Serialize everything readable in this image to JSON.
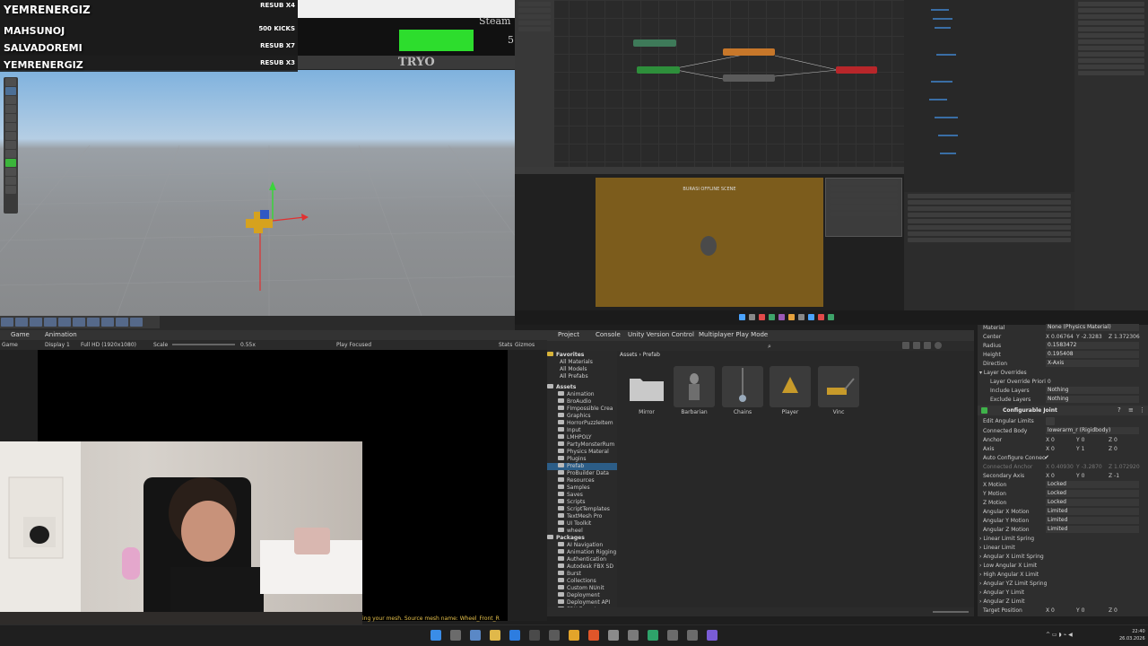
{
  "leaderboard": {
    "entries": [
      {
        "name": "YEMRENERGIZ",
        "badge": "RESUB X4"
      },
      {
        "name": "MAHSUNOJ",
        "badge": "500 KICKS"
      },
      {
        "name": "SALVADOREMI",
        "badge": "RESUB X7"
      },
      {
        "name": "YEMRENERGIZ",
        "badge": "RESUB X3"
      }
    ],
    "goal_text": "Steam",
    "goal_number": "5",
    "overlay_label": "TRYO"
  },
  "game_view": {
    "tabs": [
      "Game",
      "Animation"
    ],
    "toolbar": {
      "mode": "Game",
      "display": "Display 1",
      "resolution": "Full HD (1920x1080)",
      "scale_label": "Scale",
      "scale_value": "0.55x",
      "play_focused": "Play Focused",
      "stats": "Stats",
      "gizmos": "Gizmos"
    },
    "console_message": "ing your mesh. Source mesh name: Wheel_Front_R"
  },
  "inner_game": {
    "scene_label": "BURASI OFFLINE SCENE"
  },
  "project": {
    "tabs": [
      "Project",
      "Console",
      "Unity Version Control",
      "Multiplayer Play Mode"
    ],
    "favorites_header": "Favorites",
    "favorites": [
      "All Materials",
      "All Models",
      "All Prefabs"
    ],
    "assets_header": "Assets",
    "asset_folders": [
      "Animation",
      "BroAudio",
      "FImpossible Crea",
      "Graphics",
      "HorrorPuzzleItem",
      "Input",
      "LMHPOLY",
      "PartyMonsterRum",
      "Physics Materal",
      "Plugins",
      "Prefab",
      "ProBuilder Data",
      "Resources",
      "Samples",
      "Saves",
      "Scripts",
      "ScriptTemplates",
      "TextMesh Pro",
      "UI Toolkit",
      "wheel"
    ],
    "packages_header": "Packages",
    "package_folders": [
      "AI Navigation",
      "Animation Rigging",
      "Authentication",
      "Autodesk FBX SD",
      "Burst",
      "Collections",
      "Custom NUnit",
      "Deployment",
      "Deployment API",
      "FBX Exporter"
    ],
    "breadcrumb": [
      "Assets",
      "Prefab"
    ],
    "items": [
      {
        "name": "Mirror",
        "type": "folder"
      },
      {
        "name": "Barbarian",
        "type": "prefab"
      },
      {
        "name": "Chains",
        "type": "prefab"
      },
      {
        "name": "Player",
        "type": "prefab"
      },
      {
        "name": "Vinc",
        "type": "prefab"
      }
    ]
  },
  "inspector": {
    "material_label": "Material",
    "material_value": "None (Physics Material)",
    "center_label": "Center",
    "center_x": "0.06764",
    "center_y": "-2.3283",
    "center_z": "1.372306",
    "radius_label": "Radius",
    "radius_value": "0.1583472",
    "height_label": "Height",
    "height_value": "0.195408",
    "direction_label": "Direction",
    "direction_value": "X-Axis",
    "layer_overrides": "Layer Overrides",
    "layer_override_priority": "Layer Override Priori",
    "layer_override_priority_value": "0",
    "include_layers": "Include Layers",
    "include_layers_value": "Nothing",
    "exclude_layers": "Exclude Layers",
    "exclude_layers_value": "Nothing",
    "component_title": "Configurable Joint",
    "edit_angular_limits": "Edit Angular Limits",
    "connected_body": "Connected Body",
    "connected_body_value": "lowerarm_r (Rigidbody)",
    "anchor": "Anchor",
    "anchor_x": "0",
    "anchor_y": "0",
    "anchor_z": "0",
    "axis": "Axis",
    "axis_x": "0",
    "axis_y": "1",
    "axis_z": "0",
    "auto_configure": "Auto Configure Connec",
    "connected_anchor": "Connected Anchor",
    "connected_anchor_x": "0.40930",
    "connected_anchor_y": "-3.2870",
    "connected_anchor_z": "1.072920",
    "secondary_axis": "Secondary Axis",
    "secondary_x": "0",
    "secondary_y": "0",
    "secondary_z": "-1",
    "motions": [
      {
        "label": "X Motion",
        "value": "Locked"
      },
      {
        "label": "Y Motion",
        "value": "Locked"
      },
      {
        "label": "Z Motion",
        "value": "Locked"
      },
      {
        "label": "Angular X Motion",
        "value": "Limited"
      },
      {
        "label": "Angular Y Motion",
        "value": "Limited"
      },
      {
        "label": "Angular Z Motion",
        "value": "Limited"
      }
    ],
    "foldouts": [
      "Linear Limit Spring",
      "Linear Limit",
      "Angular X Limit Spring",
      "Low Angular X Limit",
      "High Angular X Limit",
      "Angular YZ Limit Spring",
      "Angular Y Limit",
      "Angular Z Limit"
    ],
    "target_position": "Target Position",
    "target_x": "0",
    "target_y": "0",
    "target_z": "0"
  },
  "taskbar": {
    "time": "22:40",
    "date": "26.03.2026"
  },
  "colors": {
    "goal_green": "#2ddd2d",
    "offline_scene": "#7c5c1c",
    "selected_blue": "#2c5d87"
  }
}
